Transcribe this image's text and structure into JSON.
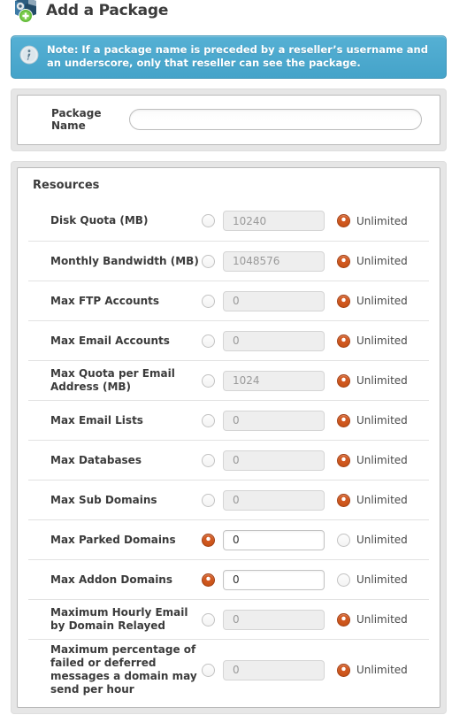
{
  "header": {
    "title": "Add a Package",
    "icon": "package-add-icon"
  },
  "note": {
    "icon": "info-icon",
    "part1_bold": "Note",
    "part2": ": If a package name is ",
    "part3_bold": "preceded",
    "part4": " by a reseller’s username and an underscore, ",
    "part5_bold": "only",
    "part6": " that reseller can see the package."
  },
  "package_name": {
    "label": "Package Name",
    "value": "",
    "placeholder": ""
  },
  "resources": {
    "title": "Resources",
    "unlimited_label": "Unlimited",
    "rows": [
      {
        "label": "Disk Quota (MB)",
        "value": "10240",
        "mode": "unlimited"
      },
      {
        "label": "Monthly Bandwidth (MB)",
        "value": "1048576",
        "mode": "unlimited"
      },
      {
        "label": "Max FTP Accounts",
        "value": "0",
        "mode": "unlimited"
      },
      {
        "label": "Max Email Accounts",
        "value": "0",
        "mode": "unlimited"
      },
      {
        "label": "Max Quota per Email Address (MB)",
        "value": "1024",
        "mode": "unlimited"
      },
      {
        "label": "Max Email Lists",
        "value": "0",
        "mode": "unlimited"
      },
      {
        "label": "Max Databases",
        "value": "0",
        "mode": "unlimited"
      },
      {
        "label": "Max Sub Domains",
        "value": "0",
        "mode": "unlimited"
      },
      {
        "label": "Max Parked Domains",
        "value": "0",
        "mode": "value"
      },
      {
        "label": "Max Addon Domains",
        "value": "0",
        "mode": "value"
      },
      {
        "label": "Maximum Hourly Email by Domain Relayed",
        "value": "0",
        "mode": "unlimited"
      },
      {
        "label": "Maximum percentage of failed or deferred messages a domain may send per hour",
        "value": "0",
        "mode": "unlimited"
      }
    ]
  },
  "colors": {
    "note_background": "#45a3c9",
    "radio_selected": "#c1500f",
    "panel_background": "#e6e6e6",
    "text": "#3b3b3b"
  }
}
